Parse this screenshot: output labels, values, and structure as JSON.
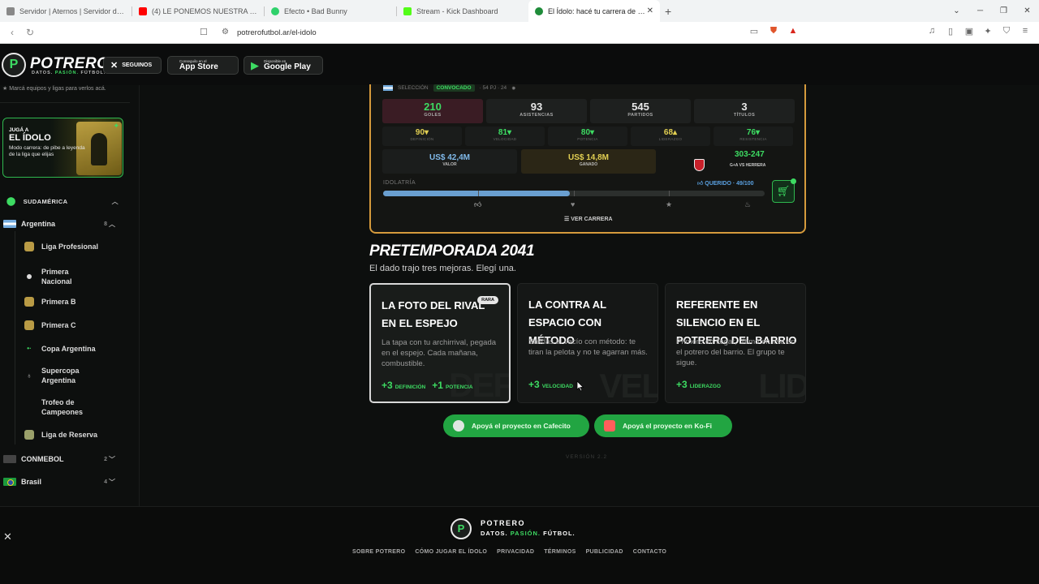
{
  "browser": {
    "tabs": [
      {
        "title": "Servidor | Aternos | Servidor de Mine",
        "color": "#888888"
      },
      {
        "title": "(4) LE PONEMOS NUESTRA VOZ A PI",
        "color": "#ff0000"
      },
      {
        "title": "Efecto • Bad Bunny",
        "color": "#2fd16b"
      },
      {
        "title": "Stream - Kick Dashboard",
        "color": "#53fc18"
      },
      {
        "title": "El Ídolo: hacé tu carrera de fútbo",
        "color": "#1f8c3a"
      }
    ],
    "url": "potrerofutbol.ar/el-idolo"
  },
  "header": {
    "brand": "POTRERO",
    "tagline_a": "DATOS. ",
    "tagline_b": "PASIÓN.",
    "tagline_c": " FÚTBOL.",
    "follow": "SEGUINOS",
    "appstore_small": "Conseguilo en el",
    "appstore_big": "App Store",
    "gplay_small": "Disponible en",
    "gplay_big": "Google Play"
  },
  "sidebar": {
    "hint": "Marcá equipos y ligas para verlos acá.",
    "promo": {
      "line1": "JUGÁ A",
      "line2": "EL ÍDOLO",
      "line3": "Modo carrera: de pibe a leyenda de la liga que elijas"
    },
    "region": "SUDAMÉRICA",
    "argentina": {
      "name": "Argentina",
      "count": "8"
    },
    "leagues": [
      "Liga Profesional",
      "Primera Nacional",
      "Primera B",
      "Primera C",
      "Copa Argentina",
      "Supercopa Argentina",
      "Trofeo de Campeones",
      "Liga de Reserva"
    ],
    "conmebol": {
      "name": "CONMEBOL",
      "count": "2"
    },
    "brasil": {
      "name": "Brasil",
      "count": "4"
    }
  },
  "career": {
    "seleccion": "SELECCIÓN",
    "convocado": "CONVOCADO",
    "caps": "· 54 PJ · 24",
    "stats": [
      {
        "value": "210",
        "label": "GOLES"
      },
      {
        "value": "93",
        "label": "ASISTENCIAS"
      },
      {
        "value": "545",
        "label": "PARTIDOS"
      },
      {
        "value": "3",
        "label": "TÍTULOS"
      }
    ],
    "attributes": [
      {
        "value": "90▾",
        "label": "DEFINICIÓN"
      },
      {
        "value": "81▾",
        "label": "VELOCIDAD"
      },
      {
        "value": "80▾",
        "label": "POTENCIA"
      },
      {
        "value": "68▴",
        "label": "LIDERAZGO"
      },
      {
        "value": "76▾",
        "label": "RESISTENCIA"
      }
    ],
    "valor": {
      "value": "US$ 42,4M",
      "label": "VALOR"
    },
    "ganado": {
      "value": "US$ 14,8M",
      "label": "GANADO"
    },
    "record": {
      "value": "303-247",
      "label": "G+A VS HERRERA"
    },
    "idolatria_label": "IDOLATRÍA",
    "idolatria_state": "QUERIDO · 49/100",
    "idolatria_fraction": 0.49,
    "ver_carrera": "VER CARRERA"
  },
  "pretemporada": {
    "title": "PRETEMPORADA 2041",
    "subtitle": "El dado trajo tres mejoras. Elegí una.",
    "options": [
      {
        "title": "LA FOTO DEL RIVAL EN EL ESPEJO",
        "tag": "RARA",
        "desc": "La tapa con tu archirrival, pegada en el espejo. Cada mañana, combustible.",
        "bonus1": "+3",
        "bonus1_label": "DEFINICIÓN",
        "bonus2": "+1",
        "bonus2_label": "POTENCIA",
        "watermark": "DEF"
      },
      {
        "title": "LA CONTRA AL ESPACIO CON MÉTODO",
        "desc": "Salidas al vacío con método: te tiran la pelota y no te agarran más.",
        "bonus1": "+3",
        "bonus1_label": "VELOCIDAD",
        "watermark": "VEL"
      },
      {
        "title": "REFERENTE EN SILENCIO EN EL POTRERO DEL BARRIO",
        "desc": "Primero en llegar, último en irse en el potrero del barrio. El grupo te sigue.",
        "bonus1": "+3",
        "bonus1_label": "LIDERAZGO",
        "watermark": "LID"
      }
    ]
  },
  "support": {
    "cafecito": "Apoyá el proyecto en Cafecito",
    "kofi": "Apoyá el proyecto en Ko-Fi"
  },
  "version": "VERSIÓN 2.2",
  "footer": {
    "brand": "POTRERO",
    "tag_a": "DATOS. ",
    "tag_b": "PASIÓN.",
    "tag_c": " FÚTBOL.",
    "links": [
      "SOBRE POTRERO",
      "CÓMO JUGAR EL ÍDOLO",
      "PRIVACIDAD",
      "TÉRMINOS",
      "PUBLICIDAD",
      "CONTACTO"
    ]
  },
  "colors": {
    "accent": "#3ddb62",
    "card_border": "#d59a3c",
    "idol_fill": "#6a9fd0"
  }
}
